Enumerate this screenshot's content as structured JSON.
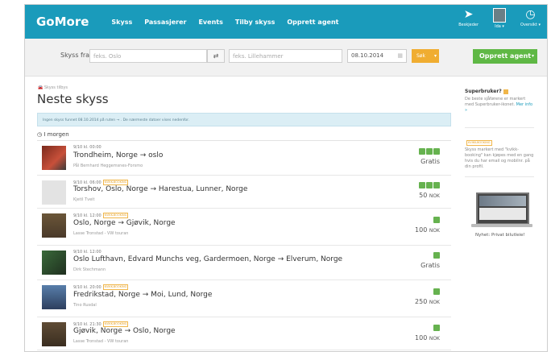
{
  "nav": {
    "logo": "GoMore",
    "links": [
      "Skyss",
      "Passasjerer",
      "Events",
      "Tilby skyss",
      "Opprett agent"
    ],
    "right": [
      {
        "icon": "paper-plane-icon",
        "label": "Beskjeder"
      },
      {
        "icon": "avatar",
        "label": "Ida ▾"
      },
      {
        "icon": "dashboard-icon",
        "label": "Oversikt ▾"
      }
    ]
  },
  "search": {
    "label": "Skyss fra",
    "from_placeholder": "feks. Oslo",
    "swap": "⇄",
    "to_placeholder": "feks. Lillehammer",
    "date": "08.10.2014",
    "submit": "Søk",
    "create_agent": "Opprett agent"
  },
  "main": {
    "breadcrumb": "Skyss tilbys",
    "title": "Neste skyss",
    "info": "Ingen skyss funnet 08.10.2014 på ruten → . De nærmeste datoer vises nedenfor.",
    "day_label": "I morgen"
  },
  "rides": [
    {
      "time": "9/10 kl. 00:00",
      "tag": "",
      "route": "Trondheim, Norge → oslo",
      "driver": "Pål Bernhard Heggemsnes-Forsmo",
      "seats": 3,
      "price": "Gratis",
      "currency": ""
    },
    {
      "time": "9/10 kl. 06:00",
      "tag": "KVIKK-BOOKING",
      "route": "Torshov, Oslo, Norge → Harestua, Lunner, Norge",
      "driver": "Kjetil Tveit",
      "seats": 3,
      "price": "50",
      "currency": "NOK"
    },
    {
      "time": "9/10 kl. 12:00",
      "tag": "KVIKK-BOOKING",
      "route": "Oslo, Norge → Gjøvik, Norge",
      "driver": "Lasse Tronstad - VW touran",
      "seats": 1,
      "price": "100",
      "currency": "NOK"
    },
    {
      "time": "9/10 kl. 12:00",
      "tag": "",
      "route": "Oslo Lufthavn, Edvard Munchs veg, Gardermoen, Norge → Elverum, Norge",
      "driver": "Dirk Stechmann",
      "seats": 1,
      "price": "Gratis",
      "currency": ""
    },
    {
      "time": "9/10 kl. 20:00",
      "tag": "KVIKK-BOOKING",
      "route": "Fredrikstad, Norge → Moi, Lund, Norge",
      "driver": "Tino Rusdal",
      "seats": 1,
      "price": "250",
      "currency": "NOK"
    },
    {
      "time": "9/10 kl. 21:30",
      "tag": "KVIKK-BOOKING",
      "route": "Gjøvik, Norge → Oslo, Norge",
      "driver": "Lasse Tronstad - VW touran",
      "seats": 1,
      "price": "100",
      "currency": "NOK"
    }
  ],
  "sidebar": {
    "super_title": "Superbruker?",
    "super_text": "De beste sjåførene er markert med Superbruker-ikonet.",
    "super_link": "Mer info »",
    "kvikk_tag": "KVIKK-BOOKING",
    "kvikk_text": "Skyss markert med \"kvikk-booking\" kan kjøpes med en gang hvis du har email og mobilnr. på din profil.",
    "promo_caption": "Nyhet: Privat bilutleie!"
  },
  "colors": {
    "nav": "#1a9bbb",
    "green": "#5fb845",
    "orange": "#f0ad31",
    "info_bg": "#dbeef5"
  }
}
